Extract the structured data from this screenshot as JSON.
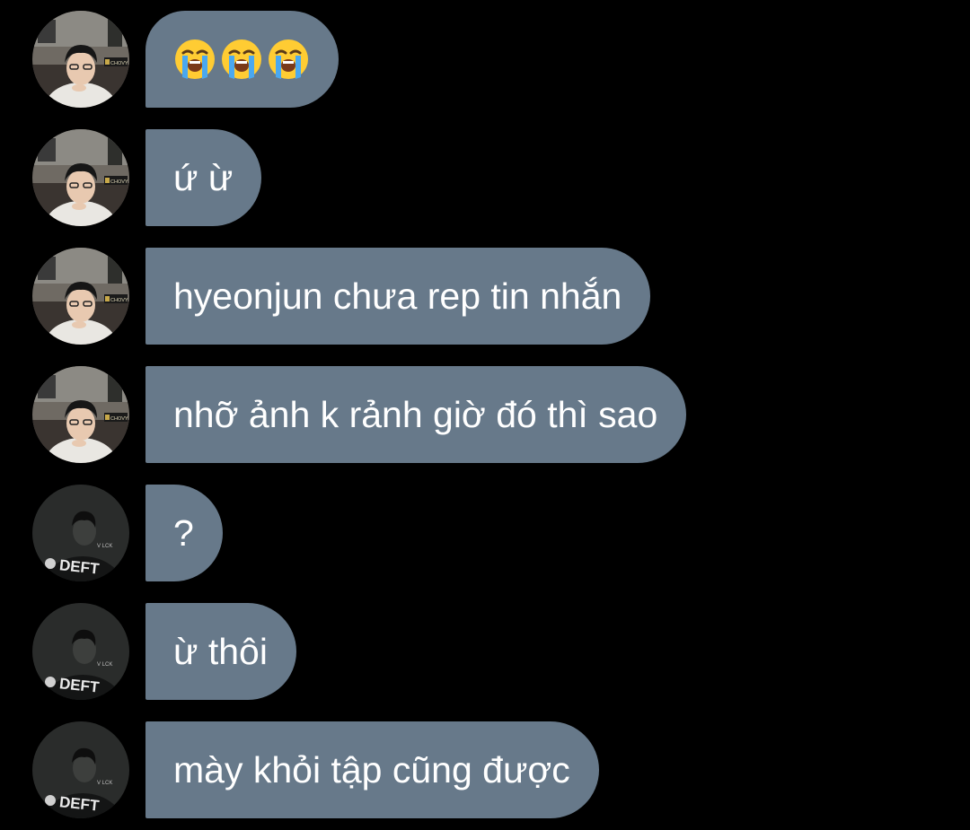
{
  "colors": {
    "background": "#000000",
    "bubble": "#67798a",
    "text": "#ffffff"
  },
  "avatars": {
    "chovy": {
      "name": "chovy-avatar",
      "badge": "CHOVY"
    },
    "deft": {
      "name": "deft-avatar",
      "label": "DEFT"
    }
  },
  "messages": [
    {
      "sender": "chovy",
      "text": "",
      "emoji": [
        "loudly-crying-face",
        "loudly-crying-face",
        "loudly-crying-face"
      ]
    },
    {
      "sender": "chovy",
      "text": "ứ ừ"
    },
    {
      "sender": "chovy",
      "text": "hyeonjun chưa rep tin nhắn"
    },
    {
      "sender": "chovy",
      "text": "nhỡ ảnh k rảnh giờ đó thì sao"
    },
    {
      "sender": "deft",
      "text": "?"
    },
    {
      "sender": "deft",
      "text": "ừ thôi"
    },
    {
      "sender": "deft",
      "text": "mày khỏi tập cũng được"
    }
  ]
}
